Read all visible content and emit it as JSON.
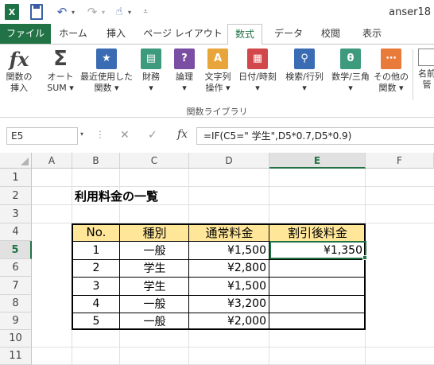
{
  "window": {
    "title": "anser18"
  },
  "qat": {
    "logo": "X",
    "icons": [
      "excel-logo",
      "save-icon",
      "undo-icon",
      "redo-icon",
      "touch-mode-icon",
      "customize-qat-icon"
    ]
  },
  "tabs": [
    "ファイル",
    "ホーム",
    "挿入",
    "ページ レイアウト",
    "数式",
    "データ",
    "校閲",
    "表示"
  ],
  "ribbon": {
    "buttons": [
      {
        "l1": "関数の",
        "l2": "挿入",
        "icon": "fx-icon"
      },
      {
        "l1": "オート",
        "l2": "SUM ▾",
        "icon": "sigma-icon"
      },
      {
        "l1": "最近使用した",
        "l2": "関数 ▾",
        "icon": "star-book-icon"
      },
      {
        "l1": "財務",
        "l2": "▾",
        "icon": "finance-book-icon"
      },
      {
        "l1": "論理",
        "l2": "▾",
        "icon": "logic-book-icon"
      },
      {
        "l1": "文字列",
        "l2": "操作 ▾",
        "icon": "text-book-icon"
      },
      {
        "l1": "日付/時刻",
        "l2": "▾",
        "icon": "date-book-icon"
      },
      {
        "l1": "検索/行列",
        "l2": "▾",
        "icon": "lookup-book-icon"
      },
      {
        "l1": "数学/三角",
        "l2": "▾",
        "icon": "math-book-icon"
      },
      {
        "l1": "その他の",
        "l2": "関数 ▾",
        "icon": "more-book-icon"
      },
      {
        "l1": "名前",
        "l2": "管",
        "icon": "name-manager-icon"
      }
    ],
    "group_label": "関数ライブラリ"
  },
  "formula_bar": {
    "name_box": "E5",
    "formula": "=IF(C5=\" 学生\",D5*0.7,D5*0.9)"
  },
  "columns": [
    "A",
    "B",
    "C",
    "D",
    "E",
    "F"
  ],
  "rows": [
    "1",
    "2",
    "3",
    "4",
    "5",
    "6",
    "7",
    "8",
    "9",
    "10",
    "11"
  ],
  "sheet": {
    "title": "利用料金の一覧",
    "headers": [
      "No.",
      "種別",
      "通常料金",
      "割引後料金"
    ],
    "rows": [
      {
        "no": "1",
        "type": "一般",
        "price": "¥1,500",
        "discount": "¥1,350"
      },
      {
        "no": "2",
        "type": "学生",
        "price": "¥2,800",
        "discount": ""
      },
      {
        "no": "3",
        "type": "学生",
        "price": "¥1,500",
        "discount": ""
      },
      {
        "no": "4",
        "type": "一般",
        "price": "¥3,200",
        "discount": ""
      },
      {
        "no": "5",
        "type": "一般",
        "price": "¥2,000",
        "discount": ""
      }
    ]
  },
  "colors": {
    "accent": "#217346",
    "header_fill": "#ffe699"
  }
}
